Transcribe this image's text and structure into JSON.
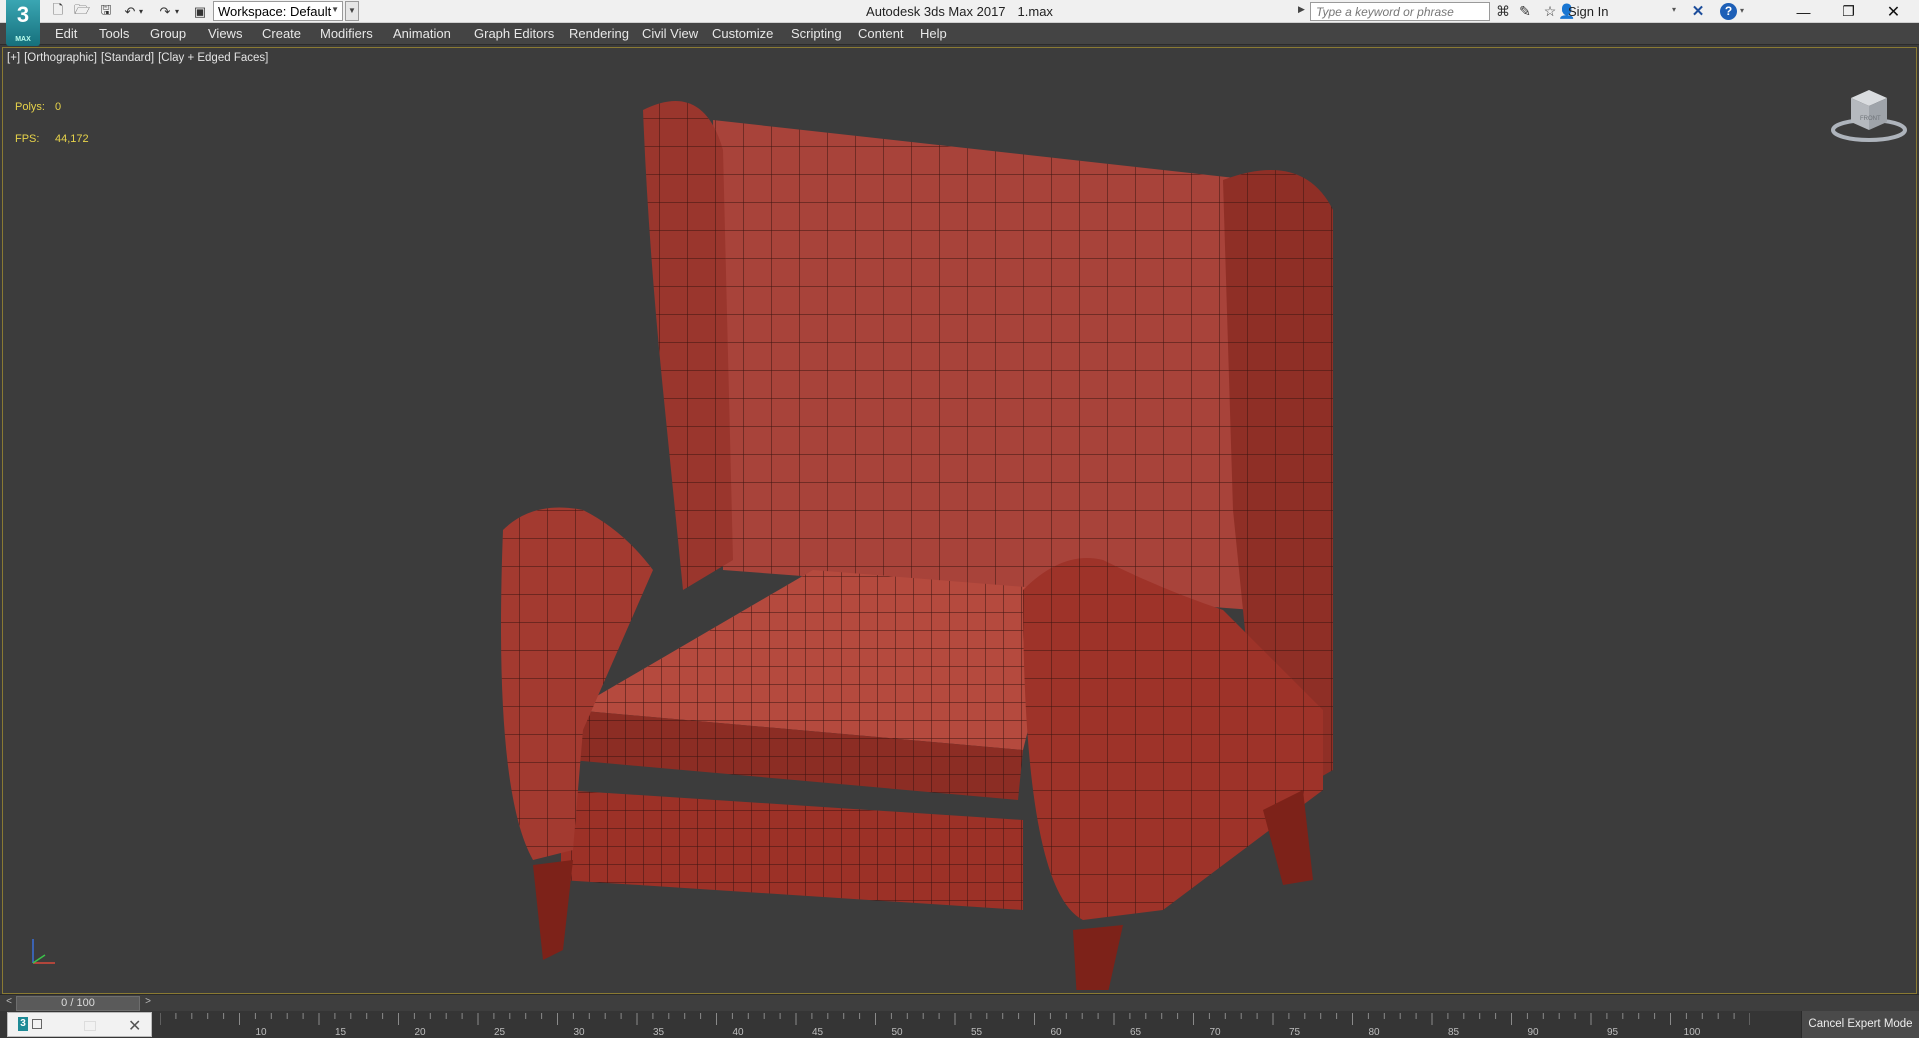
{
  "titlebar": {
    "app_name": "Autodesk 3ds Max 2017",
    "file_name": "1.max",
    "workspace": "Workspace: Default",
    "search_placeholder": "Type a keyword or phrase",
    "sign_in": "Sign In",
    "logo_text": "3",
    "logo_subtext": "MAX"
  },
  "menu": [
    "Edit",
    "Tools",
    "Group",
    "Views",
    "Create",
    "Modifiers",
    "Animation",
    "Graph Editors",
    "Rendering",
    "Civil View",
    "Customize",
    "Scripting",
    "Content",
    "Help"
  ],
  "viewport": {
    "label_plus": "[+]",
    "label_view": "[Orthographic]",
    "label_shading": "[Standard]",
    "label_style": "[Clay + Edged Faces]",
    "polys_label": "Polys:",
    "polys_value": "0",
    "fps_label": "FPS:",
    "fps_value": "44,172",
    "viewcube_face": "FRONT",
    "model_color": "#a8362a"
  },
  "timeslider": {
    "frame_display": "0 / 100",
    "prev": "<",
    "next": ">"
  },
  "ruler": {
    "labels": [
      "10",
      "15",
      "20",
      "25",
      "30",
      "35",
      "40",
      "45",
      "50",
      "55",
      "60",
      "65",
      "70",
      "75",
      "80",
      "85",
      "90",
      "95",
      "100"
    ]
  },
  "status": {
    "cancel_expert_mode": "Cancel Expert Mode"
  }
}
